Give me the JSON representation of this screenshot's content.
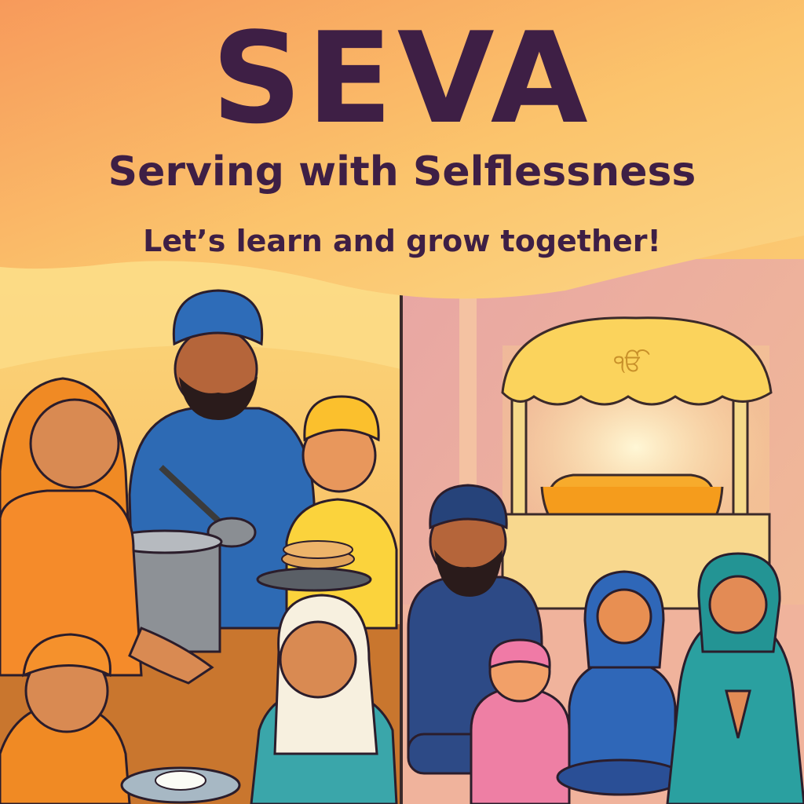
{
  "poster": {
    "title": "SEVA",
    "subtitle": "Serving with Selflessness",
    "tagline": "Let’s learn and grow together!",
    "ek_onkar_symbol": "ੴ"
  },
  "colors": {
    "title_text": "#3e1f45",
    "sky_top": "#f7a05c",
    "sky_bottom": "#fcd47a",
    "left_panel": "#fbcf6c",
    "right_panel": "#f2b49a",
    "canopy": "#fbd35c"
  },
  "scenes": {
    "left": "langar-kitchen-serving",
    "right": "gurdwara-prayer-hall"
  }
}
